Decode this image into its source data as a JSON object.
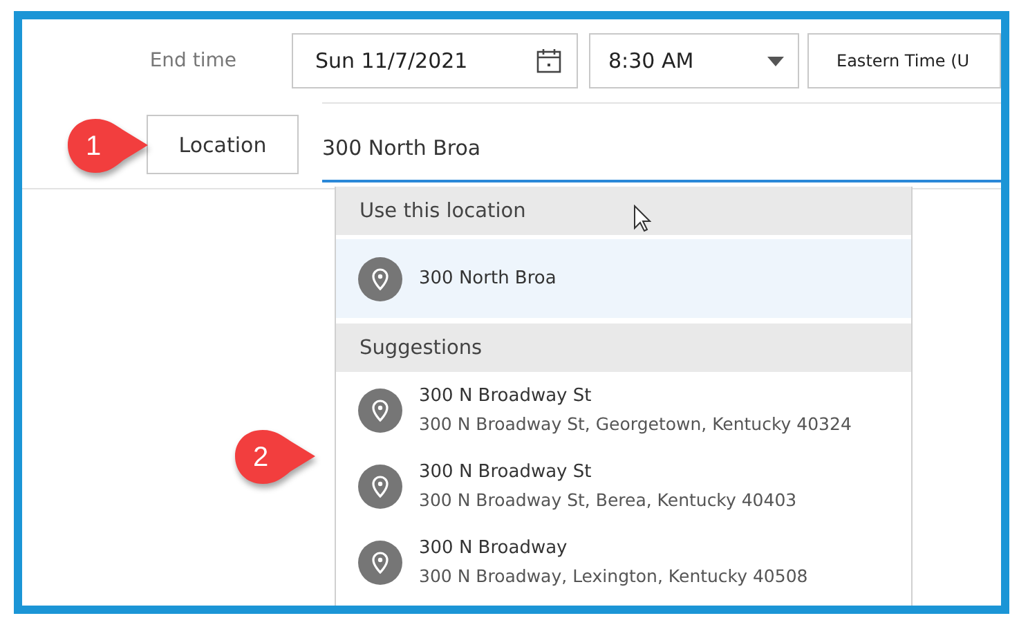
{
  "end_time": {
    "label": "End time",
    "date": "Sun 11/7/2021",
    "time": "8:30 AM",
    "timezone": "Eastern Time (U"
  },
  "location": {
    "button": "Location",
    "value": "300 North Broa"
  },
  "dropdown": {
    "sections": [
      {
        "header": "Use this location",
        "items": [
          {
            "title": "300 North Broa",
            "selected": true
          }
        ]
      },
      {
        "header": "Suggestions",
        "items": [
          {
            "title": "300 N Broadway St",
            "address": "300 N Broadway St, Georgetown, Kentucky  40324",
            "selected": false
          },
          {
            "title": "300 N Broadway St",
            "address": "300 N Broadway St, Berea, Kentucky  40403",
            "selected": false
          },
          {
            "title": "300 N Broadway",
            "address": "300 N Broadway, Lexington, Kentucky  40508",
            "selected": false
          }
        ]
      }
    ]
  },
  "callouts": [
    {
      "number": "1"
    },
    {
      "number": "2"
    }
  ]
}
